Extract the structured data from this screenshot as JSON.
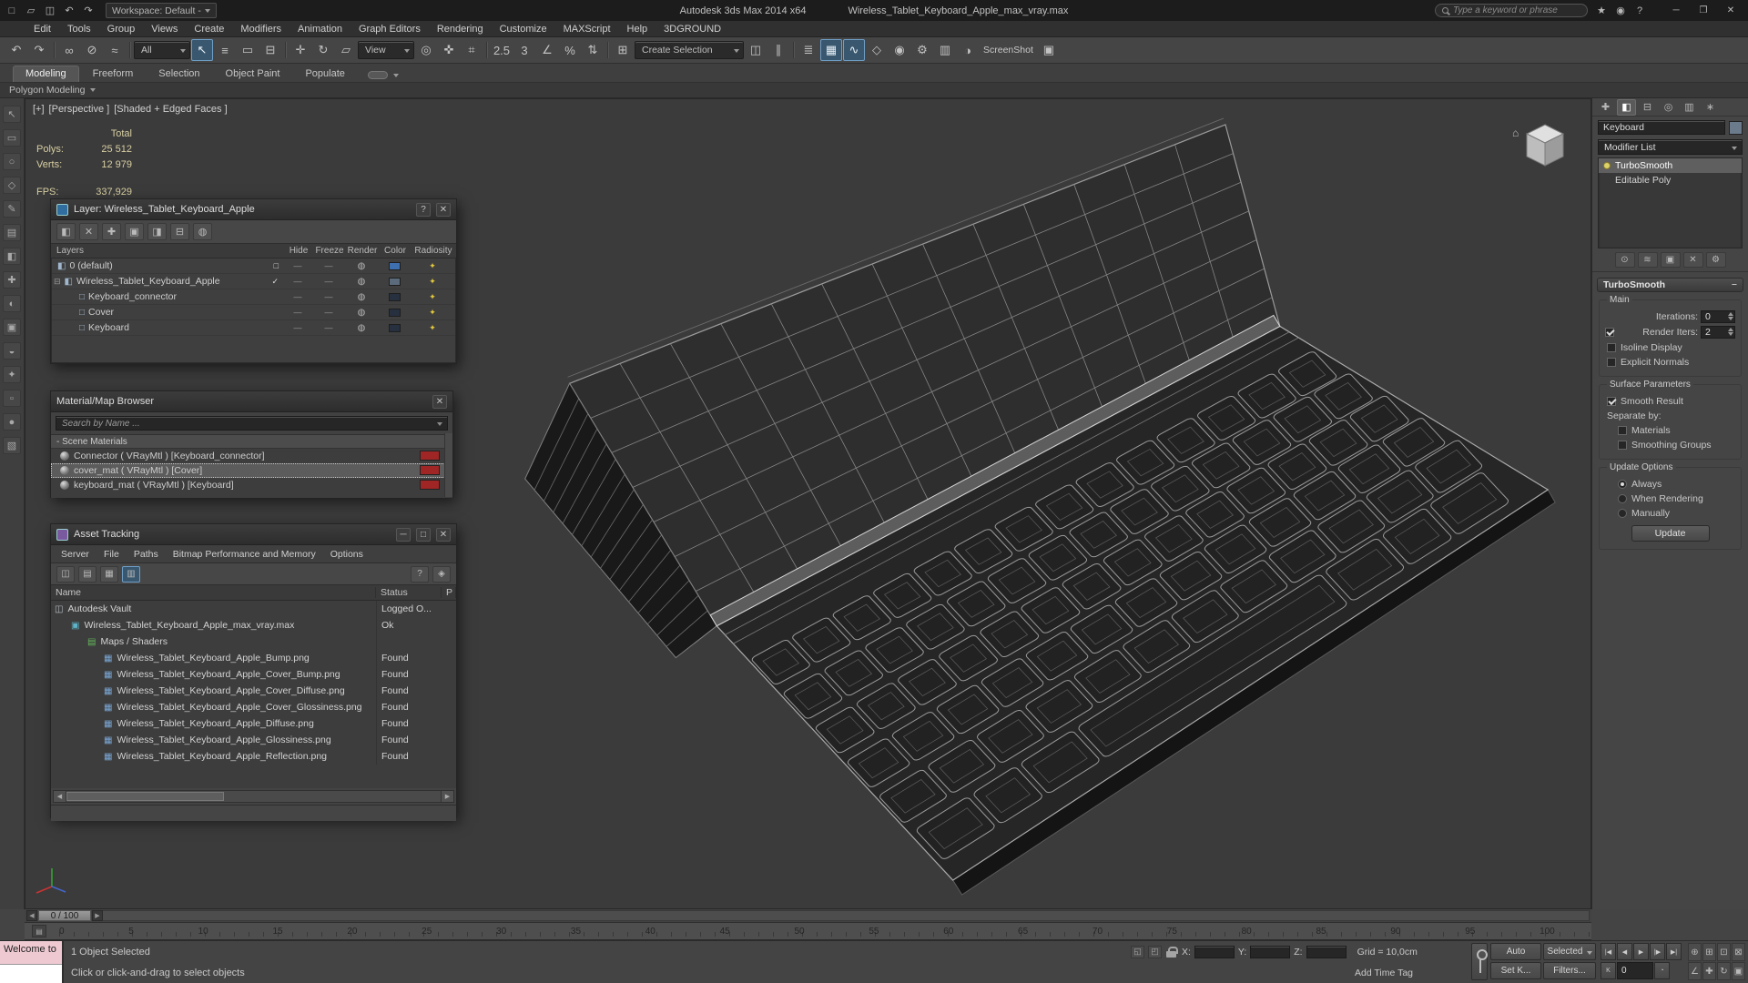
{
  "icons": {
    "dash": "—",
    "close": "✕",
    "minimize": "─",
    "restore": "❐",
    "maximize": "□",
    "help": "?",
    "left": "◀",
    "right": "▶",
    "home": "⌂",
    "minus": "−",
    "expand_minus": "⊟",
    "key_mode": "K",
    "time_config": "◔",
    "ruler_tool": "▤"
  },
  "titlebar": {
    "quick_icons": [
      {
        "n": "new-scene-icon",
        "g": "□",
        "ia": "true"
      },
      {
        "n": "open-file-icon",
        "g": "▱",
        "ia": "true"
      },
      {
        "n": "save-file-icon",
        "g": "◫",
        "ia": "true"
      },
      {
        "n": "undo-quick-icon",
        "g": "↶",
        "ia": "true"
      },
      {
        "n": "redo-quick-icon",
        "g": "↷",
        "ia": "true"
      }
    ],
    "workspace": "Workspace: Default -",
    "app_title": "Autodesk 3ds Max  2014 x64",
    "doc_title": "Wireless_Tablet_Keyboard_Apple_max_vray.max",
    "search_placeholder": "Type a keyword or phrase",
    "right_icons": [
      {
        "n": "favorites-star-icon",
        "g": "★",
        "ia": "true"
      },
      {
        "n": "community-icon",
        "g": "◉",
        "ia": "true"
      },
      {
        "n": "help-menu-icon",
        "g": "?",
        "ia": "true"
      }
    ]
  },
  "menus": [
    "Edit",
    "Tools",
    "Group",
    "Views",
    "Create",
    "Modifiers",
    "Animation",
    "Graph Editors",
    "Rendering",
    "Customize",
    "MAXScript",
    "Help",
    "3DGROUND"
  ],
  "main_toolbar": {
    "items": [
      {
        "n": "undo-icon",
        "g": "↶",
        "ia": "true"
      },
      {
        "n": "redo-icon",
        "g": "↷",
        "ia": "true"
      },
      {
        "n": "toolbar-separator",
        "sp": 1,
        "ia": "false"
      },
      {
        "n": "select-and-link-icon",
        "g": "∞",
        "ia": "true"
      },
      {
        "n": "unlink-selection-icon",
        "g": "⊘",
        "ia": "true"
      },
      {
        "n": "bind-to-spacewarp-icon",
        "g": "≈",
        "ia": "true"
      },
      {
        "n": "toolbar-separator",
        "sp": 1,
        "ia": "false"
      },
      {
        "n": "selection-filter-dropdown",
        "g": "All",
        "dd": 1,
        "ia": "true"
      },
      {
        "n": "select-object-icon",
        "g": "↖",
        "on": 1,
        "ia": "true"
      },
      {
        "n": "select-by-name-icon",
        "g": "≡",
        "ia": "true"
      },
      {
        "n": "rectangular-selection-icon",
        "g": "▭",
        "ia": "true"
      },
      {
        "n": "window-crossing-icon",
        "g": "⊟",
        "ia": "true"
      },
      {
        "n": "toolbar-separator",
        "sp": 1,
        "ia": "false"
      },
      {
        "n": "select-and-move-icon",
        "g": "✛",
        "ia": "true"
      },
      {
        "n": "select-and-rotate-icon",
        "g": "↻",
        "ia": "true"
      },
      {
        "n": "select-and-scale-icon",
        "g": "▱",
        "ia": "true"
      },
      {
        "n": "reference-coordinate-dropdown",
        "g": "View",
        "dd": 1,
        "ia": "true"
      },
      {
        "n": "use-pivot-center-icon",
        "g": "◎",
        "ia": "true"
      },
      {
        "n": "select-and-manipulate-icon",
        "g": "✜",
        "ia": "true"
      },
      {
        "n": "keyboard-override-icon",
        "g": "⌗",
        "ia": "true"
      },
      {
        "n": "toolbar-separator",
        "sp": 1,
        "ia": "false"
      },
      {
        "n": "snap-toggle-25-icon",
        "g": "2.5",
        "ia": "true"
      },
      {
        "n": "snap-toggle-3-icon",
        "g": "3",
        "ia": "true"
      },
      {
        "n": "angle-snap-icon",
        "g": "∠",
        "ia": "true"
      },
      {
        "n": "percent-snap-icon",
        "g": "%",
        "ia": "true"
      },
      {
        "n": "spinner-snap-icon",
        "g": "⇅",
        "ia": "true"
      },
      {
        "n": "toolbar-separator",
        "sp": 1,
        "ia": "false"
      },
      {
        "n": "edit-named-sets-icon",
        "g": "⊞",
        "ia": "true"
      },
      {
        "n": "named-selection-sets-field",
        "g": "Create Selection",
        "fld": 1,
        "ia": "true"
      },
      {
        "n": "mirror-icon",
        "g": "◫",
        "ia": "true"
      },
      {
        "n": "align-icon",
        "g": "∥",
        "ia": "true"
      },
      {
        "n": "toolbar-separator",
        "sp": 1,
        "ia": "false"
      },
      {
        "n": "layer-manager-icon",
        "g": "≣",
        "ia": "true"
      },
      {
        "n": "graphite-ribbon-icon",
        "g": "▦",
        "on": 1,
        "ia": "true"
      },
      {
        "n": "curve-editor-icon",
        "g": "∿",
        "on": 1,
        "ia": "true"
      },
      {
        "n": "schematic-view-icon",
        "g": "◇",
        "ia": "true"
      },
      {
        "n": "material-editor-icon",
        "g": "◉",
        "ia": "true"
      },
      {
        "n": "render-setup-icon",
        "g": "⚙",
        "ia": "true"
      },
      {
        "n": "rendered-frame-icon",
        "g": "▥",
        "ia": "true"
      },
      {
        "n": "render-production-icon",
        "g": "◑",
        "ia": "true"
      },
      {
        "n": "screenshot-label",
        "g": "ScreenShot",
        "lb": 1,
        "ia": "false"
      },
      {
        "n": "screenshot-icon",
        "g": "▣",
        "ia": "true"
      }
    ]
  },
  "ribbon": {
    "tabs": [
      {
        "label": "Modeling",
        "on": 1
      },
      {
        "label": "Freeform"
      },
      {
        "label": "Selection"
      },
      {
        "label": "Object Paint"
      },
      {
        "label": "Populate"
      }
    ],
    "subtab": "Polygon Modeling"
  },
  "dock_icons": [
    {
      "n": "dock-select-icon",
      "g": "↖"
    },
    {
      "n": "dock-rect-icon",
      "g": "▭"
    },
    {
      "n": "dock-circle-icon",
      "g": "○"
    },
    {
      "n": "dock-poly-icon",
      "g": "◇"
    },
    {
      "n": "dock-pen-icon",
      "g": "✎"
    },
    {
      "n": "dock-list-icon",
      "g": "▤"
    },
    {
      "n": "dock-half-icon",
      "g": "◧"
    },
    {
      "n": "dock-cross-icon",
      "g": "✚"
    },
    {
      "n": "dock-contrast-icon",
      "g": "◐"
    },
    {
      "n": "dock-grid-icon",
      "g": "▣"
    },
    {
      "n": "dock-dome-icon",
      "g": "◒"
    },
    {
      "n": "dock-star-icon",
      "g": "✦"
    },
    {
      "n": "dock-dot-icon",
      "g": "▫"
    },
    {
      "n": "dock-sphere-icon",
      "g": "●"
    },
    {
      "n": "dock-hatch-icon",
      "g": "▧"
    }
  ],
  "viewport": {
    "plus": "[+]",
    "view": "[Perspective ]",
    "shading": "[Shaded + Edged Faces ]",
    "stats": {
      "total": "Total",
      "polys_label": "Polys:",
      "polys": "25 512",
      "verts_label": "Verts:",
      "verts": "12 979",
      "fps_label": "FPS:",
      "fps": "337,929"
    }
  },
  "layer_dialog": {
    "title": "Layer: Wireless_Tablet_Keyboard_Apple",
    "help": "?",
    "tools": [
      {
        "n": "new-layer-icon",
        "g": "◧"
      },
      {
        "n": "delete-layer-icon",
        "g": "✕"
      },
      {
        "n": "add-to-layer-icon",
        "g": "✚"
      },
      {
        "n": "select-layer-objects-icon",
        "g": "▣"
      },
      {
        "n": "set-current-layer-icon",
        "g": "◨"
      },
      {
        "n": "hide-layers-icon",
        "g": "⊟"
      },
      {
        "n": "freeze-layers-icon",
        "g": "◍"
      }
    ],
    "columns": [
      "Layers",
      "Hide",
      "Freeze",
      "Render",
      "Color",
      "Radiosity"
    ],
    "rows": [
      {
        "name": "0 (default)",
        "ind": "2px",
        "exp": "",
        "ico": "◧",
        "cur": "□",
        "sw": "#3e6fae"
      },
      {
        "name": "Wireless_Tablet_Keyboard_Apple",
        "ind": "2px",
        "exp": "⊟",
        "ico": "◧",
        "cur": "✓",
        "sw": "#5b6b7c"
      },
      {
        "name": "Keyboard_connector",
        "ind": "26px",
        "exp": "",
        "ico": "□",
        "cur": "",
        "sw": "#26303e"
      },
      {
        "name": "Cover",
        "ind": "26px",
        "exp": "",
        "ico": "□",
        "cur": "",
        "sw": "#26303e"
      },
      {
        "name": "Keyboard",
        "ind": "26px",
        "exp": "",
        "ico": "□",
        "cur": "",
        "sw": "#26303e"
      }
    ]
  },
  "material_browser": {
    "title": "Material/Map Browser",
    "search_placeholder": "Search by Name ...",
    "section": "- Scene Materials",
    "rows": [
      {
        "label": "Connector ( VRayMtl ) [Keyboard_connector]",
        "sw": "#a02525"
      },
      {
        "label": "cover_mat ( VRayMtl ) [Cover]",
        "sw": "#a02525",
        "sel": 1
      },
      {
        "label": "keyboard_mat ( VRayMtl ) [Keyboard]",
        "sw": "#a02525"
      }
    ]
  },
  "asset_tracking": {
    "title": "Asset Tracking",
    "menus": [
      "Server",
      "File",
      "Paths",
      "Bitmap Performance and Memory",
      "Options"
    ],
    "tools": [
      {
        "n": "vault-operations-icon",
        "g": "◫"
      },
      {
        "n": "status-log-icon",
        "g": "▤"
      },
      {
        "n": "thumbnail-view-icon",
        "g": "▦"
      },
      {
        "n": "table-view-icon",
        "g": "▥",
        "on": 1
      }
    ],
    "right_tools": [
      {
        "n": "asset-help-icon",
        "g": "?"
      },
      {
        "n": "asset-options-icon",
        "g": "◈"
      }
    ],
    "columns": [
      "Name",
      "Status",
      "P"
    ],
    "rows": [
      {
        "name": "Autodesk Vault",
        "status": "Logged O...",
        "ind": "4px",
        "ico": "◫",
        "col": "#b9bec4"
      },
      {
        "name": "Wireless_Tablet_Keyboard_Apple_max_vray.max",
        "status": "Ok",
        "ind": "22px",
        "ico": "▣",
        "col": "#5fb3c9"
      },
      {
        "name": "Maps / Shaders",
        "status": "",
        "ind": "40px",
        "ico": "▤",
        "col": "#66b85c"
      },
      {
        "name": "Wireless_Tablet_Keyboard_Apple_Bump.png",
        "status": "Found",
        "ind": "58px",
        "ico": "▦",
        "col": "#7aa7d6"
      },
      {
        "name": "Wireless_Tablet_Keyboard_Apple_Cover_Bump.png",
        "status": "Found",
        "ind": "58px",
        "ico": "▦",
        "col": "#7aa7d6"
      },
      {
        "name": "Wireless_Tablet_Keyboard_Apple_Cover_Diffuse.png",
        "status": "Found",
        "ind": "58px",
        "ico": "▦",
        "col": "#7aa7d6"
      },
      {
        "name": "Wireless_Tablet_Keyboard_Apple_Cover_Glossiness.png",
        "status": "Found",
        "ind": "58px",
        "ico": "▦",
        "col": "#7aa7d6"
      },
      {
        "name": "Wireless_Tablet_Keyboard_Apple_Diffuse.png",
        "status": "Found",
        "ind": "58px",
        "ico": "▦",
        "col": "#7aa7d6"
      },
      {
        "name": "Wireless_Tablet_Keyboard_Apple_Glossiness.png",
        "status": "Found",
        "ind": "58px",
        "ico": "▦",
        "col": "#7aa7d6"
      },
      {
        "name": "Wireless_Tablet_Keyboard_Apple_Reflection.png",
        "status": "Found",
        "ind": "58px",
        "ico": "▦",
        "col": "#7aa7d6"
      }
    ]
  },
  "command_panel": {
    "tabs": [
      {
        "n": "create-tab-icon",
        "g": "✚"
      },
      {
        "n": "modify-tab-icon",
        "g": "◧",
        "on": 1
      },
      {
        "n": "hierarchy-tab-icon",
        "g": "⊟"
      },
      {
        "n": "motion-tab-icon",
        "g": "◎"
      },
      {
        "n": "display-tab-icon",
        "g": "▥"
      },
      {
        "n": "utilities-tab-icon",
        "g": "∗"
      }
    ],
    "object_name": "Keyboard",
    "object_color": "#6b7b8c",
    "modifier_list": "Modifier List",
    "stack": [
      {
        "label": "TurboSmooth",
        "on": 1,
        "bulb": 1
      },
      {
        "label": "Editable Poly"
      }
    ],
    "stack_buttons": [
      {
        "n": "pin-stack-icon",
        "g": "⊙"
      },
      {
        "n": "show-end-result-icon",
        "g": "≋"
      },
      {
        "n": "make-unique-icon",
        "g": "▣"
      },
      {
        "n": "remove-modifier-icon",
        "g": "✕"
      },
      {
        "n": "configure-modifier-sets-icon",
        "g": "⚙"
      }
    ],
    "rollout": "TurboSmooth",
    "groups": {
      "main": "Main",
      "surface": "Surface Parameters",
      "update": "Update Options"
    },
    "iterations_label": "Iterations:",
    "iterations": "0",
    "render_iters_label": "Render Iters:",
    "render_iters": "2",
    "isoline": "Isoline Display",
    "explicit": "Explicit Normals",
    "smooth_result": "Smooth Result",
    "separate_by": "Separate by:",
    "materials": "Materials",
    "smoothing_groups": "Smoothing Groups",
    "always": "Always",
    "when_rendering": "When Rendering",
    "manually": "Manually",
    "update_button": "Update"
  },
  "timeline": {
    "handle": "0 / 100",
    "ticks": [
      "0",
      "5",
      "10",
      "15",
      "20",
      "25",
      "30",
      "35",
      "40",
      "45",
      "50",
      "55",
      "60",
      "65",
      "70",
      "75",
      "80",
      "85",
      "90",
      "95",
      "100"
    ]
  },
  "statusbar": {
    "listener_line": "Welcome to",
    "selection_status": "1 Object Selected",
    "prompt": "Click or click-and-drag to select objects",
    "mini_icons": [
      {
        "n": "isolate-selection-icon",
        "g": "◱"
      },
      {
        "n": "offset-mode-icon",
        "g": "◰"
      }
    ],
    "x_label": "X:",
    "y_label": "Y:",
    "z_label": "Z:",
    "x_value": "",
    "y_value": "",
    "z_value": "",
    "grid": "Grid = 10,0cm",
    "add_time_tag": "Add Time Tag",
    "auto_key": "Auto",
    "selected_set": "Selected",
    "set_key": "Set K...",
    "key_filters": "Filters...",
    "frame": "0",
    "media_buttons": [
      {
        "n": "go-to-start-button",
        "g": "|◀"
      },
      {
        "n": "previous-frame-button",
        "g": "◀"
      },
      {
        "n": "play-animation-button",
        "g": "▶"
      },
      {
        "n": "next-frame-button",
        "g": "|▶"
      },
      {
        "n": "go-to-end-button",
        "g": "▶|"
      }
    ],
    "nav_icons": [
      {
        "n": "zoom-icon",
        "g": "⊕"
      },
      {
        "n": "zoom-all-icon",
        "g": "⊞"
      },
      {
        "n": "zoom-extents-icon",
        "g": "⊡"
      },
      {
        "n": "zoom-extents-all-icon",
        "g": "⊠"
      },
      {
        "n": "fov-icon",
        "g": "∠"
      },
      {
        "n": "pan-icon",
        "g": "✚"
      },
      {
        "n": "orbit-icon",
        "g": "↻"
      },
      {
        "n": "maximize-viewport-icon",
        "g": "▣"
      }
    ]
  }
}
